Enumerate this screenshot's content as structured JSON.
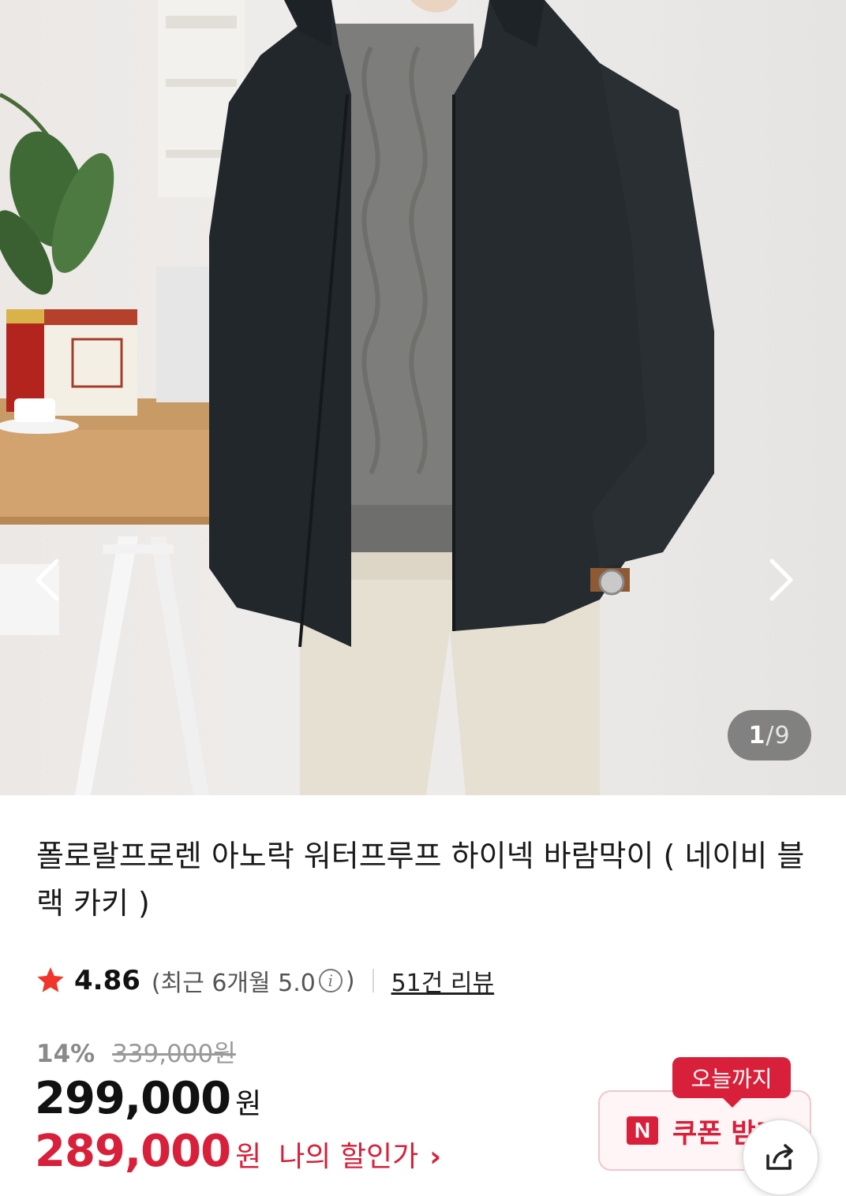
{
  "gallery": {
    "current": "1",
    "separator": "/",
    "total": "9",
    "prev_icon": "chevron-left-icon",
    "next_icon": "chevron-right-icon"
  },
  "product": {
    "title": "폴로랄프로렌 아노락 워터프루프 하이넥 바람막이 ( 네이비 블랙 카키 )",
    "rating": "4.86",
    "recent_rating": "(최근 6개월 5.0",
    "recent_rating_close": ")",
    "review_count": "51건 리뷰",
    "discount_rate": "14%",
    "original_price": "339,000원",
    "price": "299,000",
    "price_unit": "원",
    "my_price": "289,000",
    "my_price_unit": "원",
    "my_price_label": "나의 할인가",
    "my_price_chevron": "›"
  },
  "coupon": {
    "badge": "오늘까지",
    "logo": "N",
    "label": "쿠폰 받기"
  },
  "colors": {
    "accent_red": "#d8203a",
    "star": "#f0352b"
  }
}
